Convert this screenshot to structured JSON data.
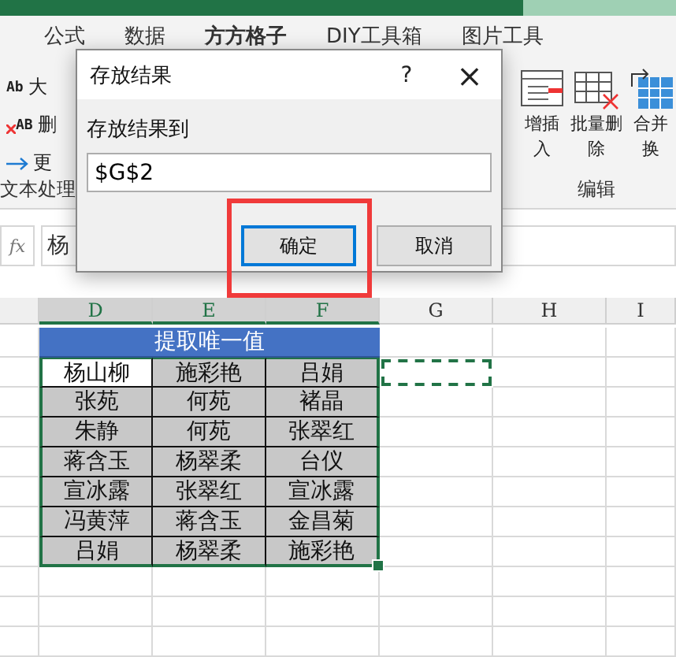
{
  "ribbon_tabs": [
    {
      "label": "公式",
      "selected": false
    },
    {
      "label": "数据",
      "selected": false
    },
    {
      "label": "方方格子",
      "selected": true
    },
    {
      "label": "DIY工具箱",
      "selected": false
    },
    {
      "label": "图片工具",
      "selected": false
    }
  ],
  "text_group": {
    "items": [
      {
        "kind": "case",
        "glyph": "Ab",
        "label": "大"
      },
      {
        "kind": "delete",
        "glyph": "AB",
        "label": "删"
      },
      {
        "kind": "arrow",
        "label": "更"
      }
    ],
    "label": "文本处理"
  },
  "edit_group": {
    "buttons": [
      {
        "kind": "insert",
        "lines": [
          "增插",
          "入"
        ]
      },
      {
        "kind": "delete",
        "lines": [
          "批量删",
          "除"
        ]
      },
      {
        "kind": "merge",
        "lines": [
          "合并",
          "换"
        ]
      }
    ],
    "label": "编辑"
  },
  "formula_bar": {
    "label": "fx",
    "value": "杨"
  },
  "sheet": {
    "columns": [
      {
        "label": "D",
        "selected": true
      },
      {
        "label": "E",
        "selected": true
      },
      {
        "label": "F",
        "selected": true
      },
      {
        "label": "G",
        "selected": false
      },
      {
        "label": "H",
        "selected": false
      },
      {
        "label": "I",
        "selected": false
      }
    ],
    "title": "提取唯一值",
    "copy_marquee": true,
    "rows": [
      [
        "杨山柳",
        "施彩艳",
        "吕娟"
      ],
      [
        "张苑",
        "何苑",
        "褚晶"
      ],
      [
        "朱静",
        "何苑",
        "张翠红"
      ],
      [
        "蒋含玉",
        "杨翠柔",
        "台仪"
      ],
      [
        "宣冰露",
        "张翠红",
        "宣冰露"
      ],
      [
        "冯黄萍",
        "蒋含玉",
        "金昌菊"
      ],
      [
        "吕娟",
        "杨翠柔",
        "施彩艳"
      ]
    ]
  },
  "dialog": {
    "title": "存放结果",
    "help": "?",
    "close": "×",
    "field_label": "存放结果到",
    "value": "$G$2",
    "buttons": [
      {
        "label": "确定",
        "default": true,
        "annotated": true
      },
      {
        "label": "取消",
        "default": false,
        "annotated": false
      }
    ]
  }
}
